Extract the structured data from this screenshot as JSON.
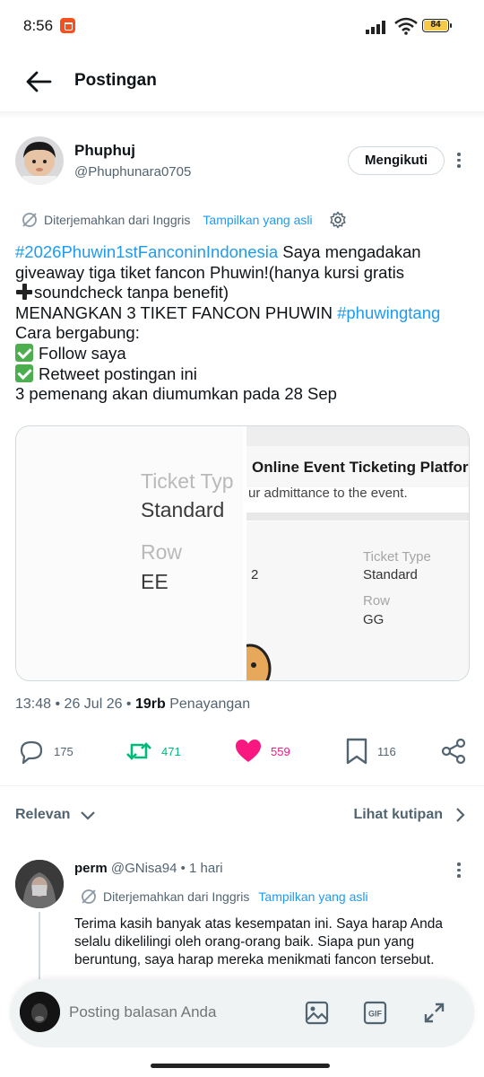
{
  "status_bar": {
    "time": "8:56",
    "battery": "84"
  },
  "header": {
    "title": "Postingan"
  },
  "author": {
    "name": "Phuphuj",
    "handle": "@Phuphunara0705",
    "follow_label": "Mengikuti"
  },
  "translation": {
    "note": "Diterjemahkan dari Inggris",
    "show_original": "Tampilkan yang asli"
  },
  "tweet": {
    "lines": {
      "l1_tag": "#2026Phuwin1stFanconinIndonesia",
      "l1_rest": " Saya mengadakan",
      "l2": "giveaway tiga tiket fancon Phuwin!(hanya kursi gratis",
      "l3": "soundcheck tanpa benefit)",
      "l4_text": "MENANGKAN 3 TIKET FANCON PHUWIN ",
      "l4_tag": "#phuwingtang",
      "l5": "Cara bergabung:",
      "l6": "Follow saya",
      "l7": "Retweet postingan ini",
      "l8": "3 pemenang akan diumumkan pada 28 Sep"
    }
  },
  "media": {
    "left": {
      "label1": "Ticket Typ",
      "value1": "Standard",
      "label2": "Row",
      "value2": "EE"
    },
    "right": {
      "title": "Online Event Ticketing Platfor",
      "subtitle": "ur admittance to the event.",
      "number": "2",
      "label1": "Ticket Type",
      "value1": "Standard",
      "label2": "Row",
      "value2": "GG"
    }
  },
  "meta": {
    "time": "13:48",
    "date": "26 Jul 26",
    "views_count": "19rb",
    "views_label": "Penayangan"
  },
  "actions": {
    "replies": "175",
    "retweets": "471",
    "likes": "559",
    "bookmarks": "116"
  },
  "sort": {
    "left_label": "Relevan",
    "right_label": "Lihat kutipan"
  },
  "reply": {
    "name": "perm",
    "handle": "@GNisa94",
    "time": "1 hari",
    "translation_note": "Diterjemahkan dari Inggris",
    "show_original": "Tampilkan yang asli",
    "text": "Terima kasih banyak atas kesempatan ini. Saya harap Anda selalu dikelilingi oleh orang-orang baik. Siapa pun yang beruntung, saya harap mereka menikmati fancon tersebut."
  },
  "compose": {
    "placeholder": "Posting balasan Anda"
  },
  "colors": {
    "accent": "#1d9bf0",
    "retweet": "#00ba7c",
    "like": "#f91880",
    "muted": "#536471"
  },
  "icons": [
    "back-arrow-icon",
    "more-vert-icon",
    "translate-icon",
    "gear-icon",
    "reply-icon",
    "retweet-icon",
    "heart-icon",
    "bookmark-icon",
    "share-icon",
    "chevron-down-icon",
    "chevron-right-icon",
    "image-icon",
    "gif-icon",
    "expand-icon"
  ]
}
